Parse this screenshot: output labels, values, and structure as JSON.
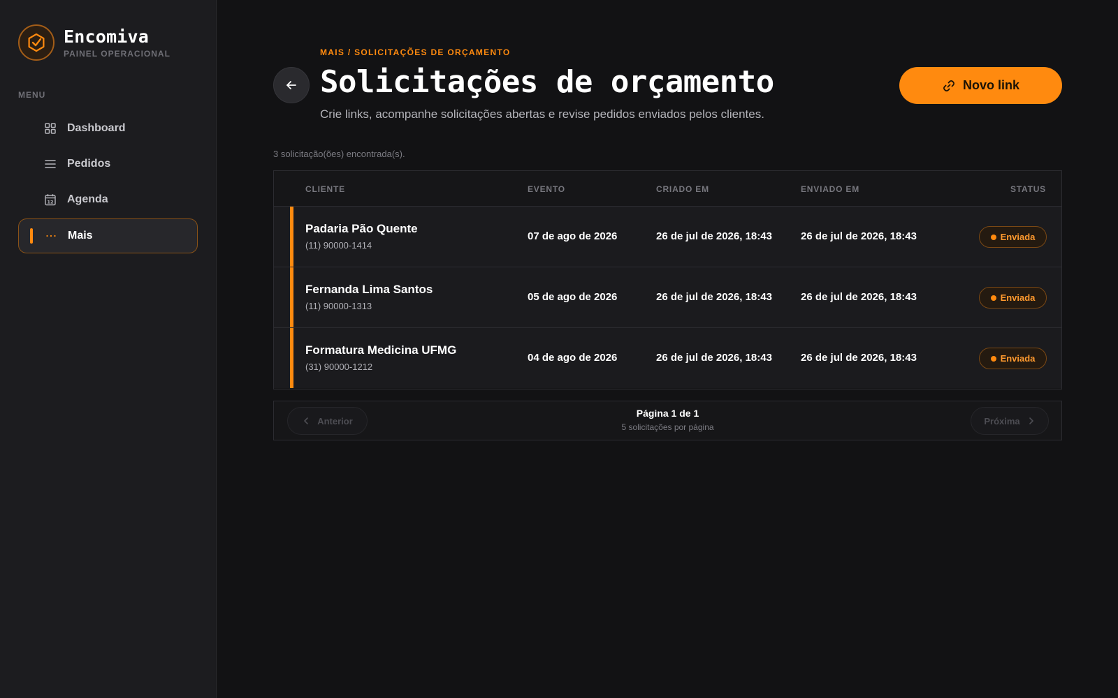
{
  "brand": {
    "name": "Encomiva",
    "subtitle": "PAINEL OPERACIONAL",
    "accent_color": "#ff8a0f"
  },
  "sidebar": {
    "menu_label": "MENU",
    "items": [
      {
        "label": "Dashboard",
        "icon": "grid-icon",
        "active": false
      },
      {
        "label": "Pedidos",
        "icon": "list-icon",
        "active": false
      },
      {
        "label": "Agenda",
        "icon": "calendar-icon",
        "active": false
      },
      {
        "label": "Mais",
        "icon": "more-dots-icon",
        "active": true
      }
    ]
  },
  "header": {
    "breadcrumb": "MAIS / SOLICITAÇÕES DE ORÇAMENTO",
    "title": "Solicitações de orçamento",
    "subtitle": "Crie links, acompanhe solicitações abertas e revise pedidos enviados pelos clientes.",
    "new_link_label": "Novo link"
  },
  "results": {
    "count_text": "3 solicitação(ões) encontrada(s)."
  },
  "table": {
    "columns": [
      "CLIENTE",
      "EVENTO",
      "CRIADO EM",
      "ENVIADO EM",
      "STATUS"
    ],
    "rows": [
      {
        "name": "Padaria Pão Quente",
        "phone": "(11) 90000-1414",
        "event": "07 de ago de 2026",
        "created": "26 de jul de 2026, 18:43",
        "sent": "26 de jul de 2026, 18:43",
        "status": "Enviada"
      },
      {
        "name": "Fernanda Lima Santos",
        "phone": "(11) 90000-1313",
        "event": "05 de ago de 2026",
        "created": "26 de jul de 2026, 18:43",
        "sent": "26 de jul de 2026, 18:43",
        "status": "Enviada"
      },
      {
        "name": "Formatura Medicina UFMG",
        "phone": "(31) 90000-1212",
        "event": "04 de ago de 2026",
        "created": "26 de jul de 2026, 18:43",
        "sent": "26 de jul de 2026, 18:43",
        "status": "Enviada"
      }
    ]
  },
  "pagination": {
    "prev_label": "Anterior",
    "next_label": "Próxima",
    "page_text": "Página 1 de 1",
    "per_page_text": "5 solicitações por página"
  }
}
